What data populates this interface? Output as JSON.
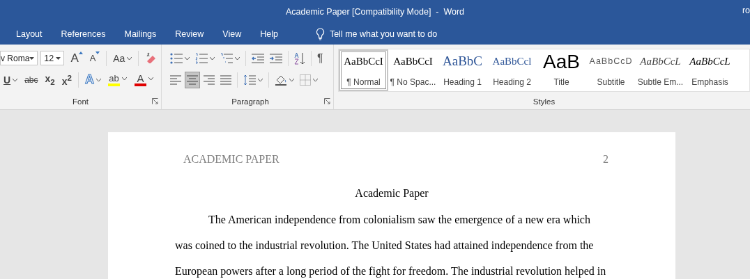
{
  "title_bar": {
    "title": "Academic Paper [Compatibility Mode]  -  Word",
    "user": "ro"
  },
  "menu_tabs": [
    {
      "label": "Layout",
      "selected": false
    },
    {
      "label": "References",
      "selected": false
    },
    {
      "label": "Mailings",
      "selected": false
    },
    {
      "label": "Review",
      "selected": false
    },
    {
      "label": "View",
      "selected": false
    },
    {
      "label": "Help",
      "selected": false
    }
  ],
  "tell_me": {
    "placeholder": "Tell me what you want to do"
  },
  "font_group": {
    "label": "Font",
    "font_name": "v Roma",
    "font_size": "12",
    "row1": [
      {
        "kind": "grow",
        "text": "A"
      },
      {
        "kind": "shrink",
        "text": "A"
      },
      {
        "kind": "case",
        "text": "Aa"
      },
      {
        "kind": "clear"
      }
    ],
    "row2": [
      {
        "kind": "underline",
        "text": "U"
      },
      {
        "kind": "strike",
        "text": "abc"
      },
      {
        "kind": "subscript",
        "text": "x$_{2}$"
      },
      {
        "kind": "superscript",
        "text": "x$^{2}$"
      },
      {
        "kind": "effects",
        "text": "A"
      },
      {
        "kind": "highlight",
        "text": "ab"
      },
      {
        "kind": "color",
        "text": "A"
      }
    ]
  },
  "paragraph_group": {
    "label": "Paragraph",
    "row1": [
      {
        "kind": "bullets"
      },
      {
        "kind": "numbering"
      },
      {
        "kind": "multilevel"
      },
      {
        "kind": "outdent"
      },
      {
        "kind": "indent"
      },
      {
        "kind": "sort"
      },
      {
        "kind": "marks",
        "text": "¶"
      }
    ],
    "row2": [
      {
        "kind": "left",
        "selected": false
      },
      {
        "kind": "center",
        "selected": true
      },
      {
        "kind": "right",
        "selected": false
      },
      {
        "kind": "justify",
        "selected": false
      },
      {
        "kind": "spacing"
      },
      {
        "kind": "shading"
      },
      {
        "kind": "borders"
      }
    ]
  },
  "styles_group": {
    "label": "Styles",
    "items": [
      {
        "kind": "normal",
        "preview": "AaBbCcI",
        "name": "¶ Normal",
        "selected": true
      },
      {
        "kind": "nospacing",
        "preview": "AaBbCcI",
        "name": "¶ No Spac...",
        "selected": false
      },
      {
        "kind": "heading1",
        "preview": "AaBbC",
        "name": "Heading 1",
        "selected": false
      },
      {
        "kind": "heading2",
        "preview": "AaBbCcl",
        "name": "Heading 2",
        "selected": false
      },
      {
        "kind": "title",
        "preview": "AaB",
        "name": "Title",
        "selected": false
      },
      {
        "kind": "subtitle",
        "preview": "AaBbCcD",
        "name": "Subtitle",
        "selected": false
      },
      {
        "kind": "subtle",
        "preview": "AaBbCcL",
        "name": "Subtle Em...",
        "selected": false
      },
      {
        "kind": "emphasis",
        "preview": "AaBbCcL",
        "name": "Emphasis",
        "selected": false
      }
    ]
  },
  "document": {
    "header": "ACADEMIC PAPER",
    "page_number": "2",
    "title": "Academic Paper",
    "paragraph": "The American independence from colonialism saw the emergence of a new era which was coined to the industrial revolution. The United States had attained independence from the European powers after a long period of the fight for freedom. The industrial revolution helped in"
  }
}
